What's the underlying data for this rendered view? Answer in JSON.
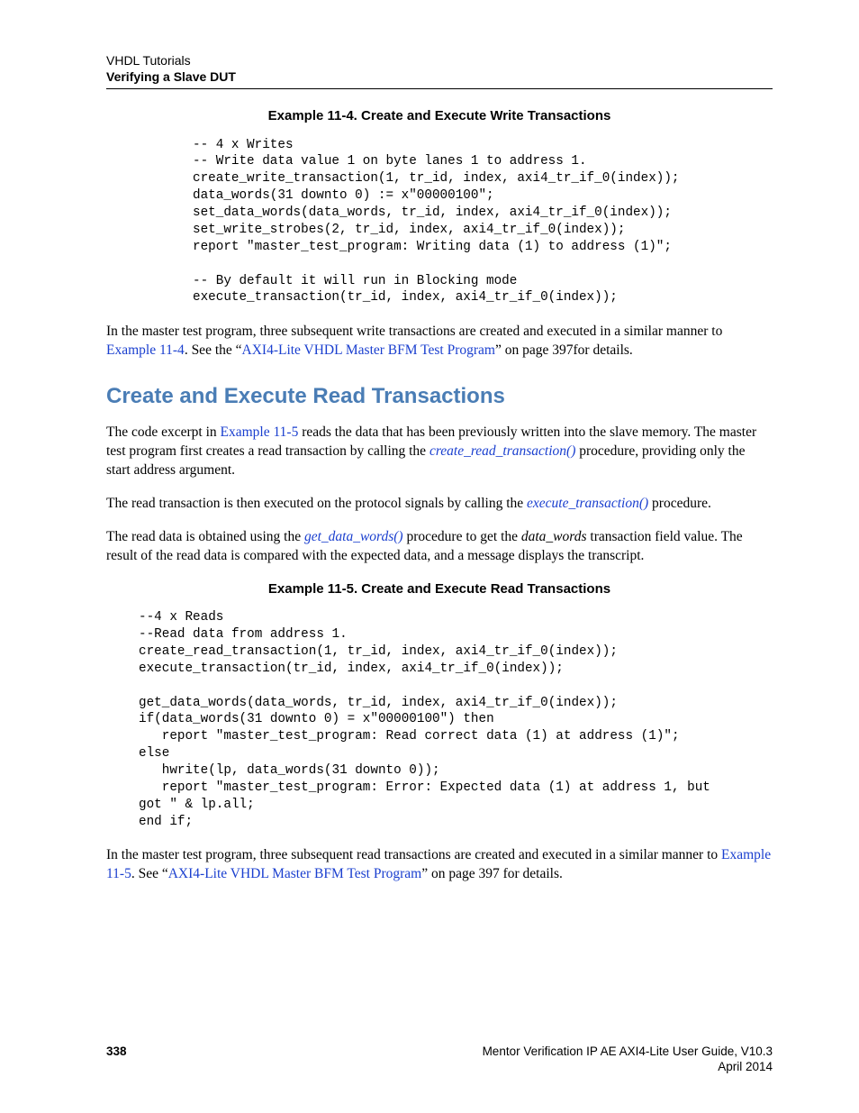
{
  "header": {
    "chapter": "VHDL Tutorials",
    "section": "Verifying a Slave DUT"
  },
  "example_11_4": {
    "title": "Example 11-4. Create and Execute Write Transactions",
    "code": "-- 4 x Writes\n-- Write data value 1 on byte lanes 1 to address 1.\ncreate_write_transaction(1, tr_id, index, axi4_tr_if_0(index));\ndata_words(31 downto 0) := x\"00000100\";\nset_data_words(data_words, tr_id, index, axi4_tr_if_0(index));\nset_write_strobes(2, tr_id, index, axi4_tr_if_0(index));\nreport \"master_test_program: Writing data (1) to address (1)\";\n\n-- By default it will run in Blocking mode\nexecute_transaction(tr_id, index, axi4_tr_if_0(index));"
  },
  "para_after_11_4": {
    "t1": "In the master test program, three subsequent write transactions are created and executed in a similar manner to ",
    "link1": "Example 11-4",
    "t2": ". See the  “",
    "link2": "AXI4-Lite VHDL Master BFM Test Program",
    "t3": "” on page 397for details."
  },
  "section_heading": "Create and Execute Read Transactions",
  "para_intro_read": {
    "t1": "The code excerpt in ",
    "link1": "Example 11-5",
    "t2": " reads the data that has been previously written into the slave memory. The master test program first creates a read transaction by calling the ",
    "link2": "create_read_transaction()",
    "t3": " procedure, providing only the start address argument."
  },
  "para_exec_read": {
    "t1": "The read transaction is then executed on the protocol signals by calling the ",
    "link1": "execute_transaction()",
    "t2": " procedure."
  },
  "para_get_words": {
    "t1": "The read data is obtained using the ",
    "link1": "get_data_words()",
    "t2": " procedure to get the ",
    "ital1": "data_words",
    "t3": " transaction field value. The result of the read data is compared with the expected data, and a message displays the transcript."
  },
  "example_11_5": {
    "title": "Example 11-5. Create and Execute Read Transactions",
    "code": "--4 x Reads\n--Read data from address 1.\ncreate_read_transaction(1, tr_id, index, axi4_tr_if_0(index));\nexecute_transaction(tr_id, index, axi4_tr_if_0(index));\n\nget_data_words(data_words, tr_id, index, axi4_tr_if_0(index));\nif(data_words(31 downto 0) = x\"00000100\") then\n   report \"master_test_program: Read correct data (1) at address (1)\";\nelse\n   hwrite(lp, data_words(31 downto 0));\n   report \"master_test_program: Error: Expected data (1) at address 1, but\ngot \" & lp.all;\nend if;"
  },
  "para_after_11_5": {
    "t1": "In the master test program, three subsequent read transactions are created and executed in a similar manner to ",
    "link1": "Example 11-5",
    "t2": ". See  “",
    "link2": "AXI4-Lite VHDL Master BFM Test Program",
    "t3": "” on page 397 for details."
  },
  "footer": {
    "page": "338",
    "title": "Mentor Verification IP AE AXI4-Lite User Guide, V10.3",
    "date": "April 2014"
  }
}
